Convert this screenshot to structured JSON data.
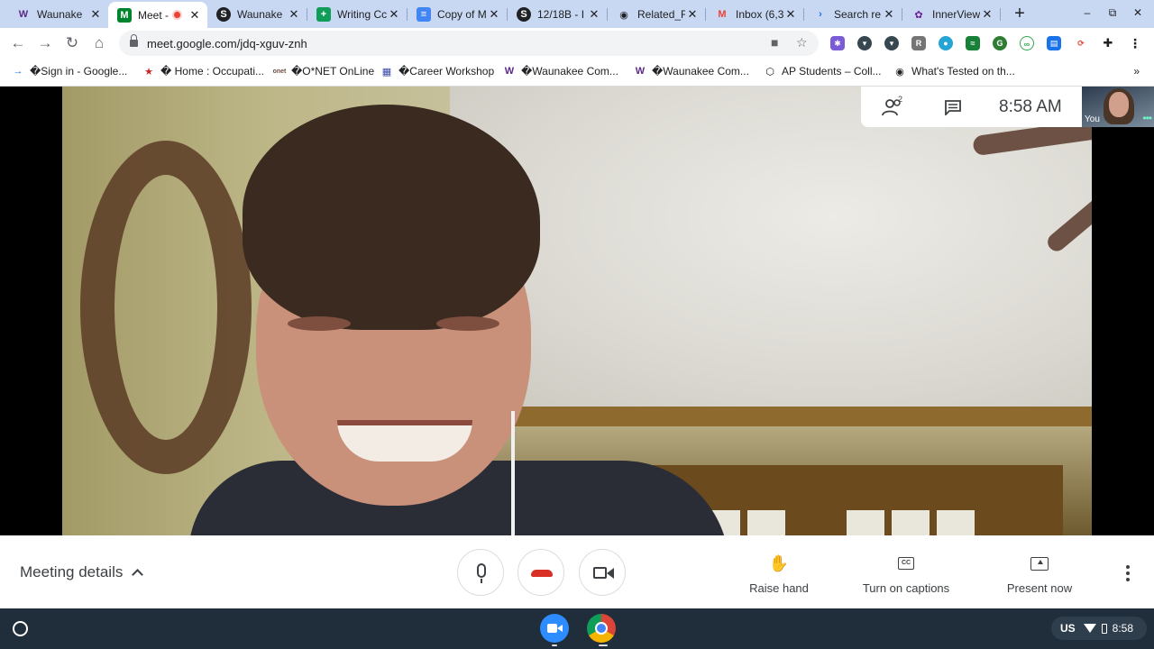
{
  "browser": {
    "tabs": [
      {
        "title": "Waunake",
        "favicon": "W",
        "favicon_color": "#5b2a86",
        "active": false
      },
      {
        "title": "Meet -",
        "favicon": "M",
        "favicon_color": "#00832d",
        "active": true,
        "recording": true
      },
      {
        "title": "Waunake",
        "favicon": "S",
        "favicon_color": "#202124",
        "active": false
      },
      {
        "title": "Writing Cc",
        "favicon": "+",
        "favicon_color": "#0f9d58",
        "active": false
      },
      {
        "title": "Copy of M",
        "favicon": "≡",
        "favicon_color": "#4285f4",
        "active": false
      },
      {
        "title": "12/18B - I",
        "favicon": "S",
        "favicon_color": "#202124",
        "active": false
      },
      {
        "title": "Related_R",
        "favicon": "◉",
        "favicon_color": "#202124",
        "active": false
      },
      {
        "title": "Inbox (6,3",
        "favicon": "M",
        "favicon_color": "#ea4335",
        "active": false
      },
      {
        "title": "Search re",
        "favicon": "›",
        "favicon_color": "#1a73e8",
        "active": false
      },
      {
        "title": "InnerView",
        "favicon": "✿",
        "favicon_color": "#6a1b9a",
        "active": false
      }
    ],
    "new_tab_label": "+",
    "url": "meet.google.com/jdq-xguv-znh"
  },
  "bookmarks": [
    {
      "label": "�Sign in - Google...",
      "icon": "→",
      "icon_color": "#1a73e8"
    },
    {
      "label": "� Home : Occupati...",
      "icon": "★",
      "icon_color": "#c62828"
    },
    {
      "label": "�O*NET OnLine",
      "icon": "onet",
      "icon_color": "#6d4c41"
    },
    {
      "label": "�Career Workshop",
      "icon": "▦",
      "icon_color": "#3949ab"
    },
    {
      "label": "�Waunakee Com...",
      "icon": "W",
      "icon_color": "#5b2a86"
    },
    {
      "label": "�Waunakee Com...",
      "icon": "W",
      "icon_color": "#5b2a86"
    },
    {
      "label": "AP Students – Coll...",
      "icon": "⬡",
      "icon_color": "#202124"
    },
    {
      "label": "What's Tested on th...",
      "icon": "◉",
      "icon_color": "#202124"
    }
  ],
  "bookmarks_overflow": "»",
  "meet": {
    "participant_count": "2",
    "clock": "8:58  AM",
    "self_view_label": "You",
    "meeting_details_label": "Meeting details",
    "raise_hand_label": "Raise hand",
    "captions_label": "Turn on captions",
    "present_label": "Present now",
    "cc_text": "CC",
    "hangup_color": "#d93025"
  },
  "shelf": {
    "locale": "US",
    "time": "8:58"
  }
}
